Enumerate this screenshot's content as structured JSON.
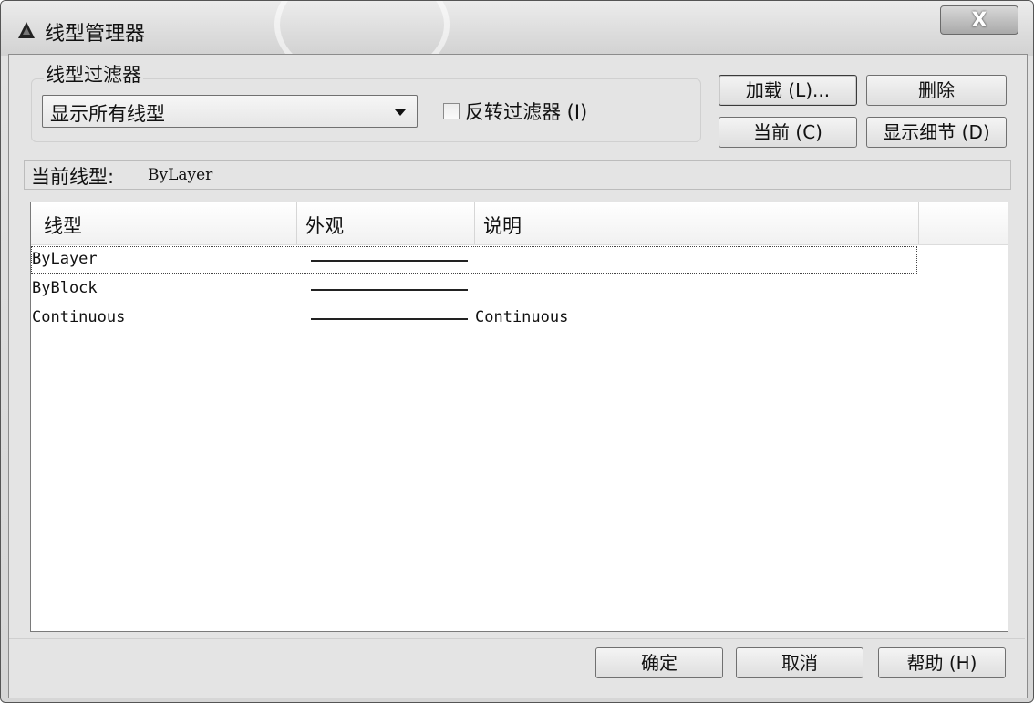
{
  "window": {
    "title": "线型管理器",
    "close_label": "X"
  },
  "filter": {
    "group_label": "线型过滤器",
    "selected_option": "显示所有线型",
    "invert_label": "反转过滤器 (I)",
    "invert_checked": false
  },
  "buttons": {
    "load": "加载 (L)...",
    "delete": "删除",
    "current": "当前 (C)",
    "show_details": "显示细节 (D)",
    "ok": "确定",
    "cancel": "取消",
    "help": "帮助 (H)"
  },
  "current_linetype": {
    "label": "当前线型:",
    "value": "ByLayer"
  },
  "table": {
    "columns": [
      "线型",
      "外观",
      "说明"
    ],
    "rows": [
      {
        "name": "ByLayer",
        "description": "",
        "selected": true
      },
      {
        "name": "ByBlock",
        "description": "",
        "selected": false
      },
      {
        "name": "Continuous",
        "description": "Continuous",
        "selected": false
      }
    ]
  },
  "icons": {
    "app": "autocad-icon",
    "close": "close-icon",
    "dropdown": "chevron-down-icon"
  }
}
